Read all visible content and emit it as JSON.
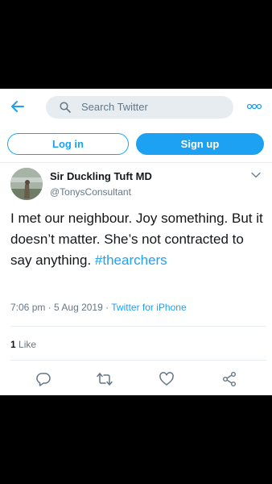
{
  "header": {
    "search_placeholder": "Search Twitter",
    "back_icon": "arrow-left-icon",
    "more_icon": "more-dots-icon"
  },
  "auth": {
    "login_label": "Log in",
    "signup_label": "Sign up"
  },
  "tweet": {
    "author_name": "Sir Duckling Tuft MD",
    "author_handle": "@TonysConsultant",
    "text_before": "I met our neighbour. Joy something. But it doesn’t matter. She’s not contracted to say anything. ",
    "hashtag": "#thearchers",
    "time": "7:06 pm",
    "date": "5 Aug 2019",
    "source": "Twitter for iPhone",
    "like_count": "1",
    "like_label": "Like"
  },
  "colors": {
    "accent": "#1da1f2",
    "muted": "#657786",
    "text": "#14171a"
  }
}
